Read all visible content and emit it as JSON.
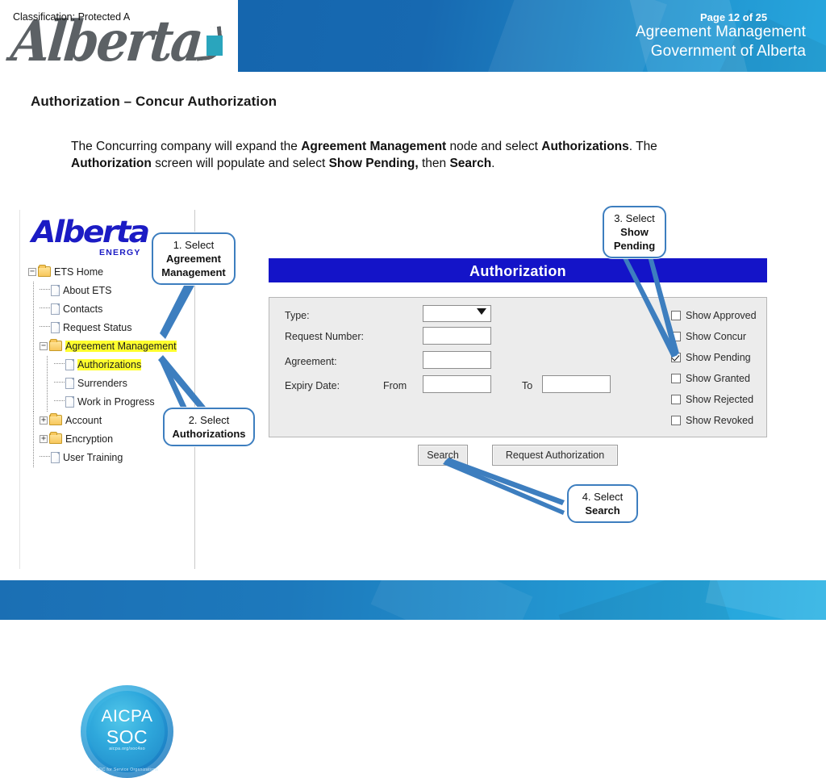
{
  "header": {
    "title_line1": "Agreement Management",
    "title_line2": "Government of Alberta",
    "wordmark": "Alberta"
  },
  "slide": {
    "title": "Authorization – Concur Authorization",
    "body": {
      "p1_a": "The Concurring company will expand the ",
      "p1_b": "Agreement Management",
      "p1_c": " node and select ",
      "p1_d": "Authorizations",
      "p1_e": ".  The ",
      "p1_f": "Authorization",
      "p1_g": " screen will populate and select ",
      "p1_h": "Show Pending,",
      "p1_i": " then ",
      "p1_j": "Search",
      "p1_k": "."
    }
  },
  "tree_panel": {
    "logo_name": "Alberta",
    "logo_sub": "ENERGY",
    "nodes": [
      {
        "label": "ETS Home",
        "icon": "folder-icon",
        "toggle": "−",
        "level": 1,
        "highlight": false
      },
      {
        "label": "About ETS",
        "icon": "page-icon",
        "toggle": "",
        "level": 2,
        "highlight": false
      },
      {
        "label": "Contacts",
        "icon": "page-icon",
        "toggle": "",
        "level": 2,
        "highlight": false
      },
      {
        "label": "Request Status",
        "icon": "page-icon",
        "toggle": "",
        "level": 2,
        "highlight": false
      },
      {
        "label": "Agreement Management",
        "icon": "folder-icon",
        "toggle": "−",
        "level": 2,
        "highlight": true
      },
      {
        "label": "Authorizations",
        "icon": "page-icon",
        "toggle": "",
        "level": 3,
        "highlight": true
      },
      {
        "label": "Surrenders",
        "icon": "page-icon",
        "toggle": "",
        "level": 3,
        "highlight": false
      },
      {
        "label": "Work in Progress",
        "icon": "page-icon",
        "toggle": "",
        "level": 3,
        "highlight": false
      },
      {
        "label": "Account",
        "icon": "folder-icon",
        "toggle": "+",
        "level": 2,
        "highlight": false
      },
      {
        "label": "Encryption",
        "icon": "folder-icon",
        "toggle": "+",
        "level": 2,
        "highlight": false
      },
      {
        "label": "User Training",
        "icon": "page-icon",
        "toggle": "",
        "level": 2,
        "highlight": false
      }
    ],
    "seal": {
      "line1": "AICPA",
      "line2": "SOC",
      "line3": "aicpa.org/soc4so",
      "line4": "SOC for Service Organizations"
    }
  },
  "auth_screen": {
    "title": "Authorization",
    "fields": {
      "type_label": "Type:",
      "type_value": "",
      "request_number_label": "Request Number:",
      "request_number_value": "",
      "agreement_label": "Agreement:",
      "agreement_value": "",
      "expiry_label": "Expiry Date:",
      "from_label": "From",
      "from_value": "",
      "to_label": "To",
      "to_value": ""
    },
    "checkboxes": [
      {
        "label": "Show Approved",
        "checked": false
      },
      {
        "label": "Show Concur",
        "checked": false
      },
      {
        "label": "Show Pending",
        "checked": true
      },
      {
        "label": "Show Granted",
        "checked": false
      },
      {
        "label": "Show Rejected",
        "checked": false
      },
      {
        "label": "Show Revoked",
        "checked": false
      }
    ],
    "buttons": {
      "search": "Search",
      "request_authorization": "Request Authorization"
    }
  },
  "callouts": [
    {
      "num": "1. Select",
      "target": "Agreement",
      "target2": "Management"
    },
    {
      "num": "2. Select",
      "target": "Authorizations",
      "target2": ""
    },
    {
      "num": "3. Select",
      "target": "Show",
      "target2": "Pending"
    },
    {
      "num": "4. Select",
      "target": "Search",
      "target2": ""
    }
  ],
  "footer": {
    "classification": "Classification: Protected A",
    "page": "Page 12 of 25"
  },
  "colors": {
    "header_blue_dark": "#1566ae",
    "header_blue_light": "#27a6dd",
    "title_bar_blue": "#1414c8",
    "highlight_yellow": "#ffff2e",
    "callout_border": "#3d7ebf",
    "logo_teal": "#2aa5bd",
    "energy_blue": "#1b1bc4"
  }
}
